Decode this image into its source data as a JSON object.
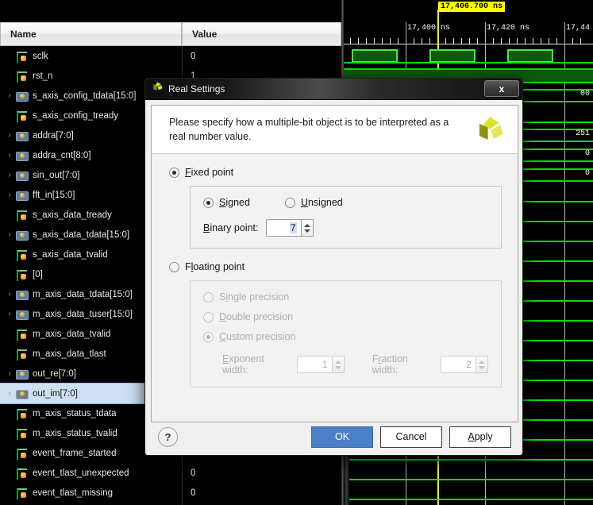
{
  "viewer": {
    "columns": {
      "name": "Name",
      "value": "Value"
    },
    "signals": [
      {
        "name": "sclk",
        "kind": "bit",
        "expandable": false,
        "value": "0"
      },
      {
        "name": "rst_n",
        "kind": "bit",
        "expandable": false,
        "value": "1"
      },
      {
        "name": "s_axis_config_tdata[15:0]",
        "kind": "bus",
        "expandable": true,
        "value": ""
      },
      {
        "name": "s_axis_config_tready",
        "kind": "bit",
        "expandable": false,
        "value": ""
      },
      {
        "name": "addra[7:0]",
        "kind": "bus",
        "expandable": true,
        "value": ""
      },
      {
        "name": "addra_cnt[8:0]",
        "kind": "bus",
        "expandable": true,
        "value": ""
      },
      {
        "name": "sin_out[7:0]",
        "kind": "bus",
        "expandable": true,
        "value": ""
      },
      {
        "name": "fft_in[15:0]",
        "kind": "bus",
        "expandable": true,
        "value": ""
      },
      {
        "name": "s_axis_data_tready",
        "kind": "bit",
        "expandable": false,
        "value": ""
      },
      {
        "name": "s_axis_data_tdata[15:0]",
        "kind": "bus",
        "expandable": true,
        "value": ""
      },
      {
        "name": "s_axis_data_tvalid",
        "kind": "bit",
        "expandable": false,
        "value": ""
      },
      {
        "name": "[0]",
        "kind": "bit",
        "expandable": false,
        "value": ""
      },
      {
        "name": "m_axis_data_tdata[15:0]",
        "kind": "bus",
        "expandable": true,
        "value": ""
      },
      {
        "name": "m_axis_data_tuser[15:0]",
        "kind": "bus",
        "expandable": true,
        "value": ""
      },
      {
        "name": "m_axis_data_tvalid",
        "kind": "bit",
        "expandable": false,
        "value": ""
      },
      {
        "name": "m_axis_data_tlast",
        "kind": "bit",
        "expandable": false,
        "value": ""
      },
      {
        "name": "out_re[7:0]",
        "kind": "bus",
        "expandable": true,
        "value": ""
      },
      {
        "name": "out_im[7:0]",
        "kind": "bus",
        "expandable": true,
        "value": "",
        "selected": true
      },
      {
        "name": "m_axis_status_tdata",
        "kind": "bit",
        "expandable": false,
        "value": ""
      },
      {
        "name": "m_axis_status_tvalid",
        "kind": "bit",
        "expandable": false,
        "value": ""
      },
      {
        "name": "event_frame_started",
        "kind": "bit",
        "expandable": false,
        "value": "0"
      },
      {
        "name": "event_tlast_unexpected",
        "kind": "bit",
        "expandable": false,
        "value": "0"
      },
      {
        "name": "event_tlast_missing",
        "kind": "bit",
        "expandable": false,
        "value": "0"
      }
    ],
    "timeline": {
      "cursor_label": "17,406.700 ns",
      "ticks": [
        "17,400 ns",
        "17,420 ns",
        "17,44"
      ]
    },
    "bus_values": [
      "00",
      "251",
      "0",
      "0"
    ],
    "colors": {
      "wave_green": "#00e000",
      "cursor_yellow": "#ffff00",
      "selection_blue": "#cfe0f4"
    }
  },
  "dialog": {
    "title": "Real Settings",
    "close_label": "x",
    "message": "Please specify how a multiple-bit object is to be interpreted as a real number value.",
    "fixed_point": {
      "label": "Fixed point",
      "selected": true,
      "signed_label": "Signed",
      "unsigned_label": "Unsigned",
      "sign_selected": "Signed",
      "binary_point_label": "Binary point:",
      "binary_point_value": "7"
    },
    "floating_point": {
      "label": "Floating point",
      "selected": false,
      "enabled": false,
      "single_label": "Single precision",
      "double_label": "Double precision",
      "custom_label": "Custom precision",
      "precision_selected": "Custom precision",
      "exponent_label": "Exponent width:",
      "exponent_value": "1",
      "fraction_label": "Fraction width:",
      "fraction_value": "2"
    },
    "buttons": {
      "help": "?",
      "ok": "OK",
      "cancel": "Cancel",
      "apply": "Apply"
    },
    "accent": "#4a80c8"
  }
}
